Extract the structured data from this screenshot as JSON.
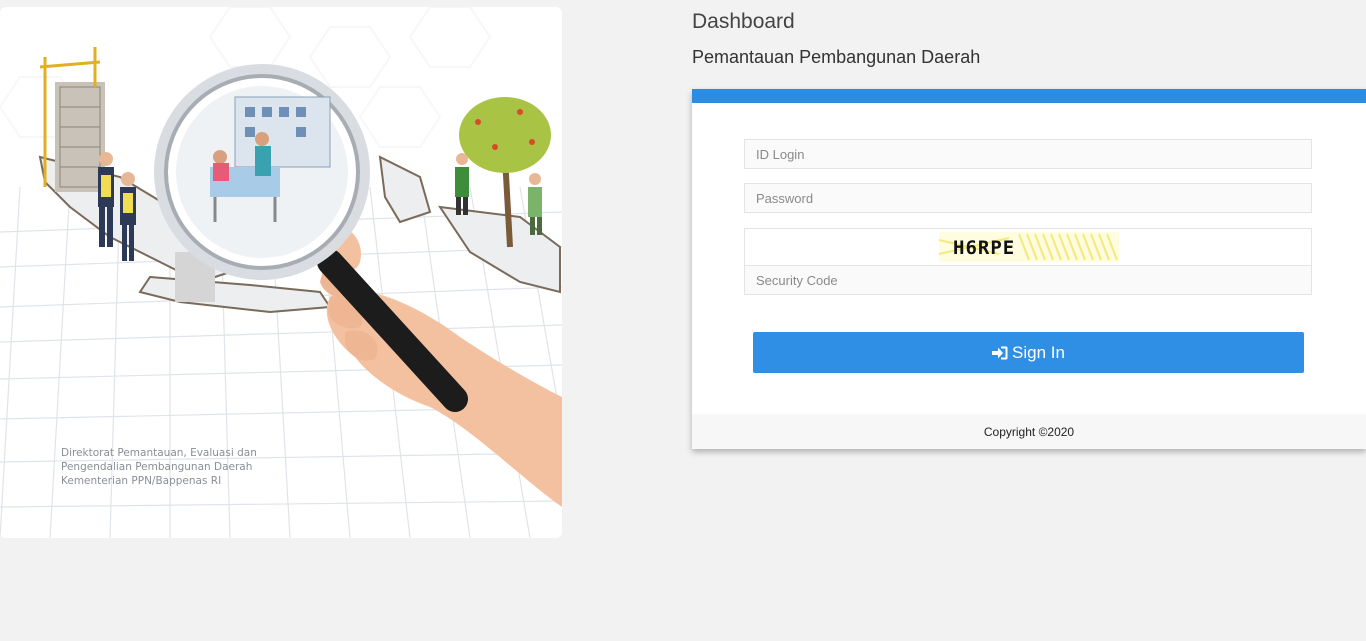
{
  "header": {
    "title": "Dashboard",
    "subtitle": "Pemantauan Pembangunan Daerah"
  },
  "hero": {
    "caption_lines": [
      "Direktorat Pemantauan, Evaluasi dan",
      "Pengendalian Pembangunan Daerah",
      "Kementerian PPN/Bappenas RI"
    ]
  },
  "login": {
    "id_placeholder": "ID Login",
    "password_placeholder": "Password",
    "captcha_text": "H6RPE",
    "security_placeholder": "Security Code",
    "signin_icon": "sign-in-icon",
    "signin_label": "Sign In",
    "copyright": "Copyright ©2020"
  },
  "colors": {
    "accent": "#2a8de2",
    "button": "#2f8fe4",
    "background": "#f2f2f2"
  }
}
